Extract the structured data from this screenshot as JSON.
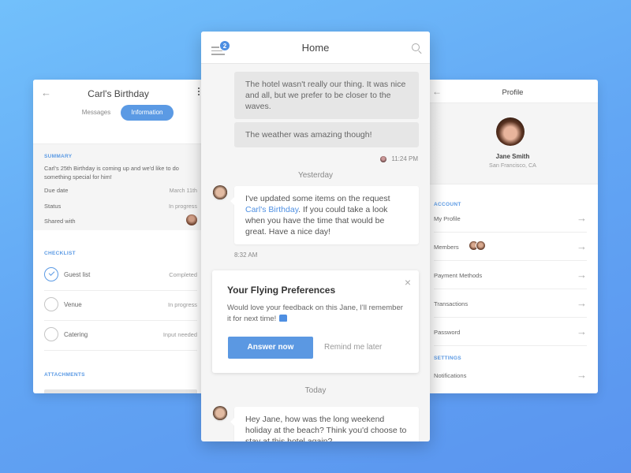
{
  "left_card": {
    "title": "Carl's Birthday",
    "back_icon": "←",
    "tabs": [
      {
        "label": "Messages",
        "active": false
      },
      {
        "label": "Information",
        "active": true
      }
    ],
    "summary": {
      "label": "SUMMARY",
      "text": "Carl's 25th Birthday is coming up and we'd like to do something special for him!",
      "fields": [
        {
          "key": "Due date",
          "value": "March 11th"
        },
        {
          "key": "Status",
          "value": "In progress"
        },
        {
          "key": "Shared with",
          "value": ""
        }
      ]
    },
    "checklist": {
      "label": "CHECKLIST",
      "items": [
        {
          "label": "Guest list",
          "status": "Completed",
          "done": true
        },
        {
          "label": "Venue",
          "status": "In progress",
          "done": false
        },
        {
          "label": "Catering",
          "status": "Input needed",
          "done": false
        }
      ]
    },
    "attachments_label": "ATTACHMENTS"
  },
  "center_card": {
    "title": "Home",
    "notification_count": "2",
    "messages": {
      "msg1": "The hotel wasn't really our thing. It was nice and all, but we prefer to be closer to the waves.",
      "msg2": "The weather was amazing though!",
      "time1": "11:24 PM",
      "day1": "Yesterday",
      "msg3_before": "I've updated some items on the request ",
      "msg3_link": "Carl's Birthday",
      "msg3_after": ". If you could take a look when you have the time that would be great. Have a nice day!",
      "time2": "8:32 AM",
      "day2": "Today",
      "msg4": "Hey Jane, how was the long weekend holiday at the beach? Think you'd choose to stay at this hotel again?"
    },
    "preferences_card": {
      "title": "Your Flying Preferences",
      "body": "Would love your feedback on this Jane, I'll remember it for next time!",
      "primary_button": "Answer now",
      "secondary_button": "Remind me later",
      "close": "×"
    }
  },
  "right_card": {
    "title": "Profile",
    "back_icon": "←",
    "user": {
      "name": "Jane Smith",
      "location": "San Francisco, CA"
    },
    "account_label": "ACCOUNT",
    "account_items": [
      "My Profile",
      "Members",
      "Payment Methods",
      "Transactions",
      "Password"
    ],
    "settings_label": "SETTINGS",
    "settings_items": [
      "Notifications"
    ],
    "arrow": "→"
  },
  "colors": {
    "accent": "#5b9ae4",
    "background_start": "#72c0fb",
    "background_end": "#5a94ef"
  }
}
